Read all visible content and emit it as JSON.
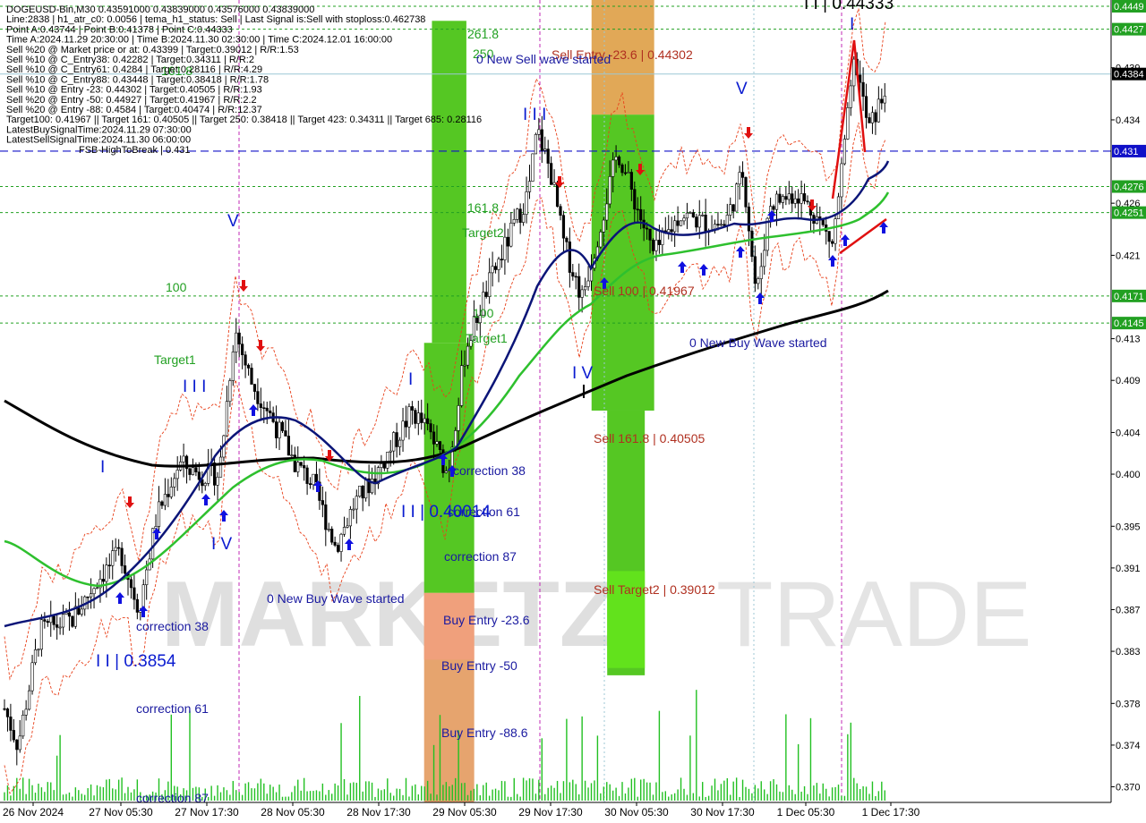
{
  "info": {
    "lines": [
      "DOGEUSD-Bin,M30  0.43591000 0.43839000 0.43576000 0.43839000",
      "Line:2838 | h1_atr_c0: 0.0056 | tema_h1_status: Sell | Last Signal is:Sell with stoploss:0.462738",
      "Point A:0.43744 | Point B:0.41378 | Point C:0.44333",
      "Time A:2024.11.29 20:30:00 | Time B:2024.11.30 02:30:00 | Time C:2024.12.01 16:00:00",
      "Sell %20 @ Market price or at: 0.43399 | Target:0.39012 | R/R:1.53",
      "Sell %10 @ C_Entry38: 0.42282 | Target:0.34311 | R/R:2",
      "Sell %10 @ C_Entry61: 0.4284 | Target:0.28116 | R/R:4.29",
      "Sell %10 @ C_Entry88: 0.43448 | Target:0.38418 | R/R:1.78",
      "Sell %10 @ Entry -23: 0.44302 | Target:0.40505 | R/R:1.93",
      "Sell %20 @ Entry -50: 0.44927 | Target:0.41967 | R/R:2.2",
      "Sell %20 @ Entry -88: 0.4584 | Target:0.40474 | R/R:12.37",
      "Target100: 0.41967 || Target 161: 0.40505 || Target 250: 0.38418 || Target 423: 0.34311 || Target 685: 0.28116",
      "LatestBuySignalTime:2024.11.29 07:30:00",
      "LatestSellSignalTime:2024.11.30 06:00:00",
      "FSB-HighToBreak | 0.431"
    ]
  },
  "watermark": {
    "part1": "MARKETZI",
    "part2": "TRADE"
  },
  "annotations": {
    "fib_261": "261.8",
    "fib_250": "250",
    "fib_161": "161.8",
    "fib_100a": "100",
    "fib_100b": "100",
    "fib_161b": "161.8",
    "target1a": "Target1",
    "target1b": "Target1",
    "target2": "Target2",
    "sell_entry": "Sell Entry -23.6 | 0.44302",
    "new_sell_wave": "0 New Sell wave started",
    "sell_100": "Sell 100 | 0.41967",
    "sell_161": "Sell 161.8 | 0.40505",
    "sell_target2": "Sell Target2 | 0.39012",
    "new_buy_wave_a": "0 New Buy Wave started",
    "new_buy_wave_b": "0 New Buy Wave started",
    "buy_entry_23": "Buy Entry -23.6",
    "buy_entry_50": "Buy Entry -50",
    "buy_entry_88": "Buy Entry -88.6",
    "corr38a": "correction 38",
    "corr61a": "correction 61",
    "corr87a": "correction 87",
    "corr38b": "correction 38",
    "corr61b": "correction 61",
    "corr87b": "correction 87",
    "wave_II_a": "I I | 0.3854",
    "wave_II_b": "I I | 0.40014",
    "wave_II_c": "I I | 0.44333",
    "wave_I_a": "I",
    "wave_I_b": "I",
    "wave_I_c": "I",
    "wave_III_a": "I I I",
    "wave_III_b": "I I I",
    "wave_IV_a": "I V",
    "wave_IV_b": "I V",
    "wave_V_a": "V",
    "wave_V_b": "V"
  },
  "chart_data": {
    "type": "candlestick",
    "symbol": "DOGEUSD-Bin,M30",
    "ylim": [
      0.3685,
      0.4455
    ],
    "y_ticks": [
      "0.439",
      "0.434",
      "0.426",
      "0.421",
      "0.413",
      "0.409",
      "0.404",
      "0.400",
      "0.395",
      "0.391",
      "0.387",
      "0.383",
      "0.378",
      "0.374",
      "0.370"
    ],
    "y_tick_values": [
      0.439,
      0.434,
      0.426,
      0.421,
      0.413,
      0.409,
      0.404,
      0.4,
      0.395,
      0.391,
      0.387,
      0.383,
      0.378,
      0.374,
      0.37
    ],
    "y_badges": [
      {
        "label": "0.4449",
        "value": 0.4449,
        "color": "#22a022"
      },
      {
        "label": "0.4427",
        "value": 0.4427,
        "color": "#22a022"
      },
      {
        "label": "0.4384",
        "value": 0.4384,
        "color": "#000000"
      },
      {
        "label": "0.431",
        "value": 0.431,
        "color": "#1010c8"
      },
      {
        "label": "0.4276",
        "value": 0.4276,
        "color": "#22a022"
      },
      {
        "label": "0.4251",
        "value": 0.4251,
        "color": "#22a022"
      },
      {
        "label": "0.4171",
        "value": 0.4171,
        "color": "#22a022"
      },
      {
        "label": "0.4145",
        "value": 0.4145,
        "color": "#22a022"
      }
    ],
    "x_ticks": [
      "26 Nov 2024",
      "27 Nov 05:30",
      "27 Nov 17:30",
      "28 Nov 05:30",
      "28 Nov 17:30",
      "29 Nov 05:30",
      "29 Nov 17:30",
      "30 Nov 05:30",
      "30 Nov 17:30",
      "1 Dec 05:30",
      "1 Dec 17:30"
    ],
    "hlines": [
      {
        "value": 0.4449,
        "style": "dotted",
        "color": "#22a022"
      },
      {
        "value": 0.4427,
        "style": "dotted",
        "color": "#22a022"
      },
      {
        "value": 0.4384,
        "style": "solid",
        "color": "#9cc7d6"
      },
      {
        "value": 0.431,
        "style": "dashed",
        "color": "#1010c8"
      },
      {
        "value": 0.4276,
        "style": "dotted",
        "color": "#22a022"
      },
      {
        "value": 0.4251,
        "style": "dotted",
        "color": "#22a022"
      },
      {
        "value": 0.4171,
        "style": "dotted",
        "color": "#22a022"
      },
      {
        "value": 0.4145,
        "style": "dotted",
        "color": "#22a022"
      }
    ],
    "zones": [
      {
        "x0": 0.378,
        "x1": 0.418,
        "y0": 0.4455,
        "y1": 0.4345,
        "color": "#e1a857"
      },
      {
        "x0": 0.378,
        "x1": 0.418,
        "y0": 0.4345,
        "y1": 0.4061,
        "color": "#55c723"
      },
      {
        "x0": 0.388,
        "x1": 0.412,
        "y0": 0.4061,
        "y1": 0.3807,
        "color": "#55c723"
      },
      {
        "x0": 0.388,
        "x1": 0.412,
        "y0": 0.3907,
        "y1": 0.3814,
        "color": "#62e21c"
      },
      {
        "x0": 0.276,
        "x1": 0.298,
        "y0": 0.4435,
        "y1": 0.4126,
        "color": "#55c723"
      },
      {
        "x0": 0.271,
        "x1": 0.303,
        "y0": 0.4126,
        "y1": 0.3886,
        "color": "#55c723"
      },
      {
        "x0": 0.271,
        "x1": 0.303,
        "y0": 0.3886,
        "y1": 0.3685,
        "color": "#e6a46e"
      },
      {
        "x0": 0.271,
        "x1": 0.303,
        "y0": 0.3886,
        "y1": 0.3822,
        "color": "#f0a07c"
      }
    ]
  }
}
